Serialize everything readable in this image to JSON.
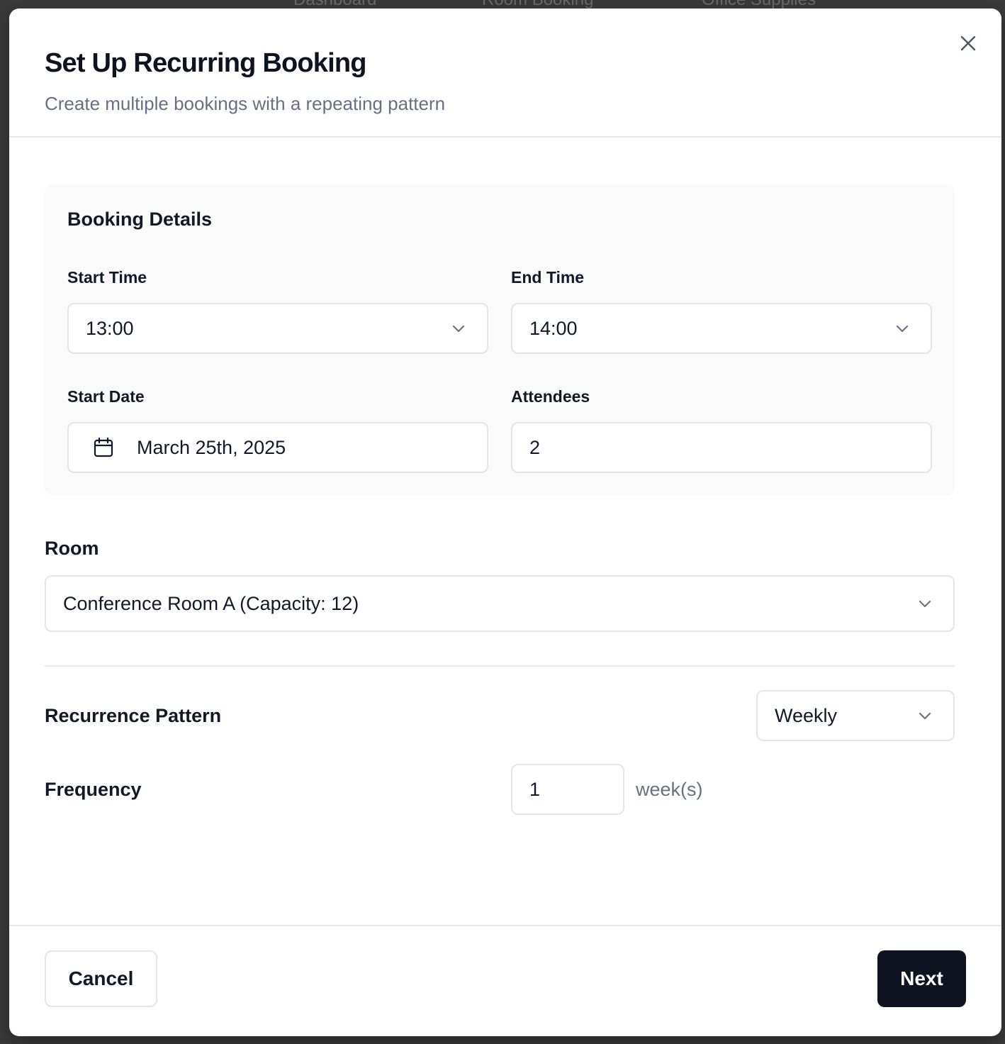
{
  "background": {
    "nav_items": [
      "Dashboard",
      "Room Booking",
      "Office Supplies"
    ]
  },
  "dialog": {
    "title": "Set Up Recurring Booking",
    "subtitle": "Create multiple bookings with a repeating pattern",
    "close_icon": "close-icon"
  },
  "booking_details": {
    "heading": "Booking Details",
    "start_time": {
      "label": "Start Time",
      "value": "13:00"
    },
    "end_time": {
      "label": "End Time",
      "value": "14:00"
    },
    "start_date": {
      "label": "Start Date",
      "value": "March 25th, 2025",
      "icon": "calendar-icon"
    },
    "attendees": {
      "label": "Attendees",
      "value": "2"
    }
  },
  "room": {
    "label": "Room",
    "value": "Conference Room A (Capacity: 12)"
  },
  "recurrence": {
    "label": "Recurrence Pattern",
    "value": "Weekly"
  },
  "frequency": {
    "label": "Frequency",
    "value": "1",
    "unit": "week(s)"
  },
  "footer": {
    "cancel_label": "Cancel",
    "next_label": "Next"
  },
  "colors": {
    "primary_button": "#0f1320",
    "muted_text": "#667085",
    "border": "#e3e5ea"
  }
}
